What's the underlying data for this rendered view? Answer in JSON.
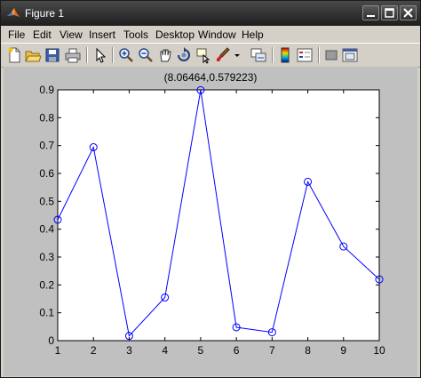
{
  "window": {
    "title": "Figure 1"
  },
  "menu": {
    "items": [
      "File",
      "Edit",
      "View",
      "Insert",
      "Tools",
      "Desktop",
      "Window",
      "Help"
    ]
  },
  "toolbar": {
    "buttons": [
      "new-figure",
      "open-file",
      "save-figure",
      "print-figure",
      "edit-plot",
      "zoom-in",
      "zoom-out",
      "pan",
      "rotate-3d",
      "data-cursor",
      "brush",
      "link-plot",
      "insert-colorbar",
      "insert-legend",
      "hide-plot-tools",
      "show-plot-tools"
    ]
  },
  "plot": {
    "coordinate_readout": "(8.06464,0.579223)"
  },
  "chart_data": {
    "type": "line",
    "marker": "circle",
    "line_color": "#0000ff",
    "x": [
      1,
      2,
      3,
      4,
      5,
      6,
      7,
      8,
      9,
      10
    ],
    "y": [
      0.434,
      0.694,
      0.017,
      0.155,
      0.899,
      0.048,
      0.03,
      0.57,
      0.338,
      0.22
    ],
    "xlim": [
      1,
      10
    ],
    "ylim": [
      0,
      0.9
    ],
    "xticks": [
      "1",
      "2",
      "3",
      "4",
      "5",
      "6",
      "7",
      "8",
      "9",
      "10"
    ],
    "yticks": [
      "0",
      "0.1",
      "0.2",
      "0.3",
      "0.4",
      "0.5",
      "0.6",
      "0.7",
      "0.8",
      "0.9"
    ],
    "title": "",
    "xlabel": "",
    "ylabel": "",
    "grid": false,
    "legend": false
  }
}
